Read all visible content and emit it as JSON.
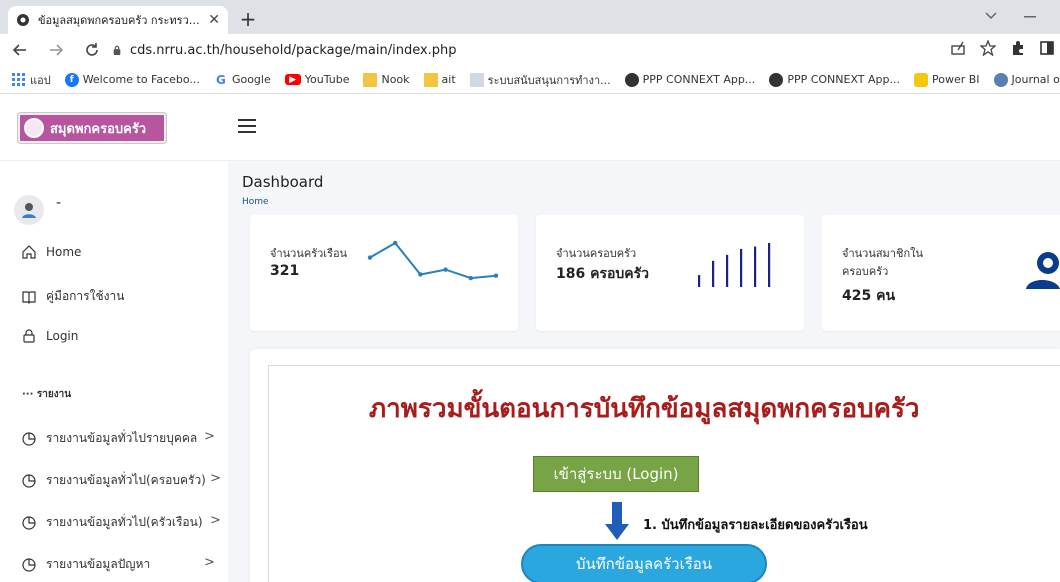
{
  "browser": {
    "tab_title": "ข้อมูลสมุดพกครอบครัว กระทรวงพัฒนา",
    "tab_close": "✕",
    "new_tab": "+",
    "url": "cds.nrru.ac.th/household/package/main/index.php",
    "bookmarks": [
      {
        "label": "แอป",
        "icon": "apps-grid-icon"
      },
      {
        "label": "Welcome to Facebo...",
        "icon": "facebook-icon",
        "color": "#1877f2"
      },
      {
        "label": "Google",
        "icon": "google-icon",
        "color": "#4285f4"
      },
      {
        "label": "YouTube",
        "icon": "youtube-icon",
        "color": "#ff0000"
      },
      {
        "label": "Nook",
        "icon": "folder-icon",
        "color": "#f4c542"
      },
      {
        "label": "ait",
        "icon": "folder-icon",
        "color": "#f4c542"
      },
      {
        "label": "ระบบสนับสนุนการทำงา...",
        "icon": "page-icon"
      },
      {
        "label": "PPP CONNEXT App...",
        "icon": "ppp-icon"
      },
      {
        "label": "PPP CONNEXT App...",
        "icon": "ppp-icon"
      },
      {
        "label": "Power BI",
        "icon": "powerbi-icon",
        "color": "#f2c811"
      },
      {
        "label": "Journal of Accounta...",
        "icon": "journal-icon"
      }
    ]
  },
  "app": {
    "logo_text": "สมุดพกครอบครัว",
    "user_name": "-",
    "menu": {
      "home": "Home",
      "manual": "คู่มือการใช้งาน",
      "login": "Login",
      "report_heading": "··· รายงาน",
      "reports": [
        "รายงานข้อมูลทั่วไปรายบุคคล",
        "รายงานข้อมูลทั่วไป(ครอบครัว)",
        "รายงานข้อมูลทั่วไป(ครัวเรือน)",
        "รายงานข้อมูลปัญหา"
      ]
    },
    "page_title": "Dashboard",
    "breadcrumb": "Home",
    "cards": {
      "households_label": "จำนวนครัวเรือน",
      "households_value": "321",
      "households_sparkline": [
        2.6,
        3.8,
        1.2,
        1.6,
        0.9,
        1.1
      ],
      "families_label": "จำนวนครอบครัว",
      "families_value": "186 ครอบครัว",
      "families_bars": [
        1,
        2.2,
        2.7,
        3.2,
        3.4,
        3.7
      ],
      "members_label_1": "จำนวนสมาชิกใน",
      "members_label_2": "ครอบครัว",
      "members_value": "425 คน"
    },
    "flow": {
      "title": "ภาพรวมขั้นตอนการบันทึกข้อมูลสมุดพกครอบครัว",
      "login_box": "เข้าสู่ระบบ (Login)",
      "step1": "1. บันทึกข้อมูลรายละเอียดของครัวเรือน",
      "household_box": "บันทึกข้อมูลครัวเรือน"
    },
    "colors": {
      "logo": "#b8559f",
      "sparkline": "#2a7fc1",
      "bars": "#1a237e",
      "flow_title": "#a81c1c",
      "login_box": "#77a444",
      "household_box": "#2ba7e0"
    }
  }
}
